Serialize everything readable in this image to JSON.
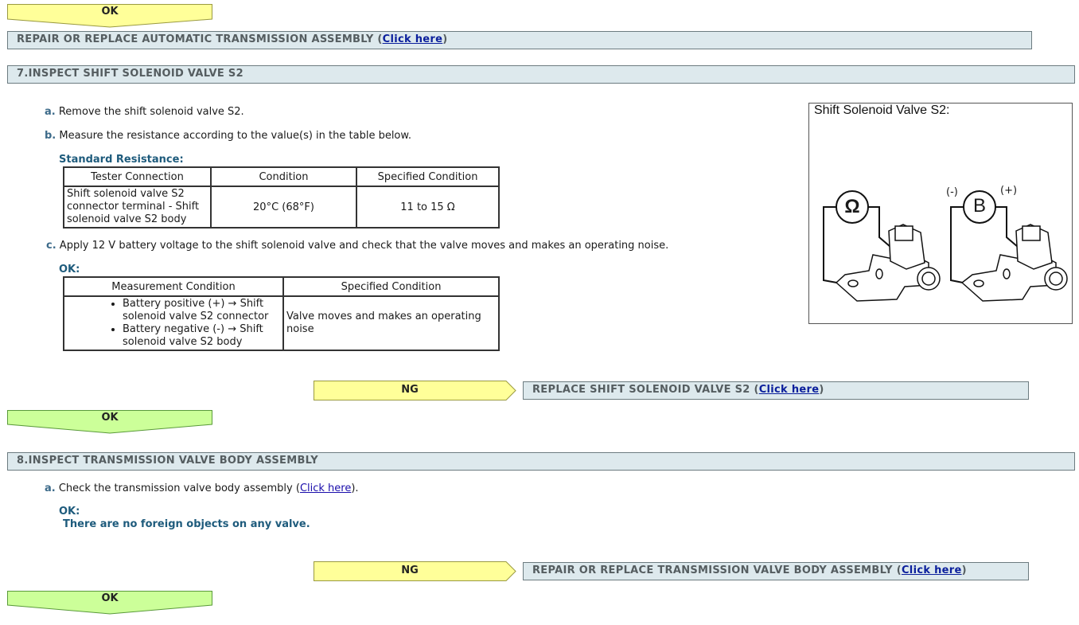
{
  "top_ok": "OK",
  "repair_at": {
    "text": "REPAIR OR REPLACE AUTOMATIC TRANSMISSION ASSEMBLY (",
    "link": "Click here",
    "close": ")"
  },
  "step7": {
    "title": "7.INSPECT SHIFT SOLENOID VALVE S2",
    "a_letter": "a.",
    "a_text": "Remove the shift solenoid valve S2.",
    "b_letter": "b.",
    "b_text": "Measure the resistance according to the value(s) in the table below.",
    "std_label": "Standard Resistance:",
    "table1": {
      "headers": [
        "Tester Connection",
        "Condition",
        "Specified Condition"
      ],
      "row": [
        "Shift solenoid valve S2 connector terminal - Shift solenoid valve S2 body",
        "20°C (68°F)",
        "11 to 15 Ω"
      ]
    },
    "c_letter": "c.",
    "c_text": "Apply 12 V battery voltage to the shift solenoid valve and check that the valve moves and makes an operating noise.",
    "ok_label": "OK:",
    "table2": {
      "headers": [
        "Measurement Condition",
        "Specified Condition"
      ],
      "bullets": [
        "Battery positive (+) → Shift solenoid valve S2 connector",
        "Battery negative (-) → Shift solenoid valve S2 body"
      ],
      "result": "Valve moves and makes an operating noise"
    },
    "figure": {
      "title": "Shift Solenoid Valve S2:",
      "ohm": "Ω",
      "b": "B",
      "minus": "(-)",
      "plus": "(+)"
    },
    "ng": "NG",
    "ng_text": "REPLACE SHIFT SOLENOID VALVE S2 (",
    "ng_link": "Click here",
    "ng_close": ")",
    "ok": "OK"
  },
  "step8": {
    "title": "8.INSPECT TRANSMISSION VALVE BODY ASSEMBLY",
    "a_letter": "a.",
    "a_text": "Check the transmission valve body assembly (",
    "a_link": "Click here",
    "a_close": ").",
    "ok_label": "OK:",
    "ok_text": "There are no foreign objects on any valve.",
    "ng": "NG",
    "ng_text": "REPAIR OR REPLACE TRANSMISSION VALVE BODY ASSEMBLY (",
    "ng_link": "Click here",
    "ng_close": ")",
    "ok": "OK"
  },
  "colors": {
    "ok_yellow": "#ffff99",
    "ok_green": "#ccff99",
    "ng_yellow": "#ffff99",
    "bar_bg": "#dde9ed"
  }
}
